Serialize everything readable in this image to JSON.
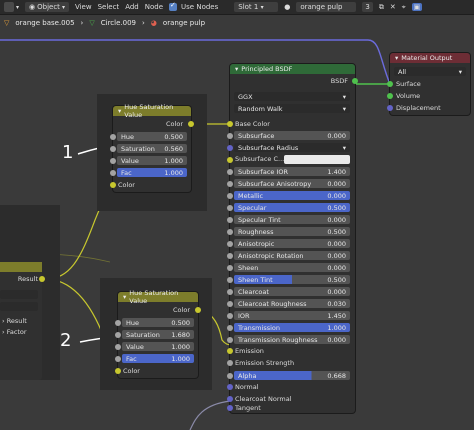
{
  "topbar": {
    "object_mode": "Object",
    "menus": [
      "View",
      "Select",
      "Add",
      "Node"
    ],
    "use_nodes_label": "Use Nodes",
    "slot_label": "Slot 1",
    "material_name": "orange pulp",
    "user_count": "3"
  },
  "breadcrumb": {
    "items": [
      "orange base.005",
      "Circle.009",
      "orange pulp"
    ]
  },
  "annotations": [
    "1",
    "2"
  ],
  "hsv_node_1": {
    "title": "Hue Saturation Value",
    "output_label": "Color",
    "fields": [
      {
        "label": "Hue",
        "value": "0.500"
      },
      {
        "label": "Saturation",
        "value": "0.560"
      },
      {
        "label": "Value",
        "value": "1.000"
      },
      {
        "label": "Fac",
        "value": "1.000"
      }
    ],
    "input_label": "Color"
  },
  "hsv_node_2": {
    "title": "Hue Saturation Value",
    "output_label": "Color",
    "fields": [
      {
        "label": "Hue",
        "value": "0.500"
      },
      {
        "label": "Saturation",
        "value": "1.680"
      },
      {
        "label": "Value",
        "value": "1.000"
      },
      {
        "label": "Fac",
        "value": "1.000"
      }
    ],
    "input_label": "Color"
  },
  "left_node": {
    "output_label": "Result",
    "inputs": [
      "Result",
      "Factor"
    ]
  },
  "bsdf": {
    "title": "Principled BSDF",
    "output_label": "BSDF",
    "distribution": "GGX",
    "subsurface_method": "Random Walk",
    "base_color_label": "Base Color",
    "subsurface": {
      "label": "Subsurface",
      "value": "0.000"
    },
    "subsurface_radius": "Subsurface Radius",
    "subsurface_color": "Subsurface C...",
    "fields": [
      {
        "label": "Subsurface IOR",
        "value": "1.400"
      },
      {
        "label": "Subsurface Anisotropy",
        "value": "0.000"
      },
      {
        "label": "Metallic",
        "value": "0.000"
      },
      {
        "label": "Specular",
        "value": "0.500"
      },
      {
        "label": "Specular Tint",
        "value": "0.000"
      },
      {
        "label": "Roughness",
        "value": "0.500"
      },
      {
        "label": "Anisotropic",
        "value": "0.000"
      },
      {
        "label": "Anisotropic Rotation",
        "value": "0.000"
      },
      {
        "label": "Sheen",
        "value": "0.000"
      },
      {
        "label": "Sheen Tint",
        "value": "0.500"
      },
      {
        "label": "Clearcoat",
        "value": "0.000"
      },
      {
        "label": "Clearcoat Roughness",
        "value": "0.030"
      },
      {
        "label": "IOR",
        "value": "1.450"
      },
      {
        "label": "Transmission",
        "value": "1.000"
      },
      {
        "label": "Transmission Roughness",
        "value": "0.000"
      }
    ],
    "emission": "Emission",
    "emission_strength": "Emission Strength",
    "alpha": {
      "label": "Alpha",
      "value": "0.668"
    },
    "normal": "Normal",
    "clearcoat_normal": "Clearcoat Normal",
    "tangent": "Tangent"
  },
  "material_output": {
    "title": "Material Output",
    "target": "All",
    "inputs": [
      "Surface",
      "Volume",
      "Displacement"
    ]
  }
}
